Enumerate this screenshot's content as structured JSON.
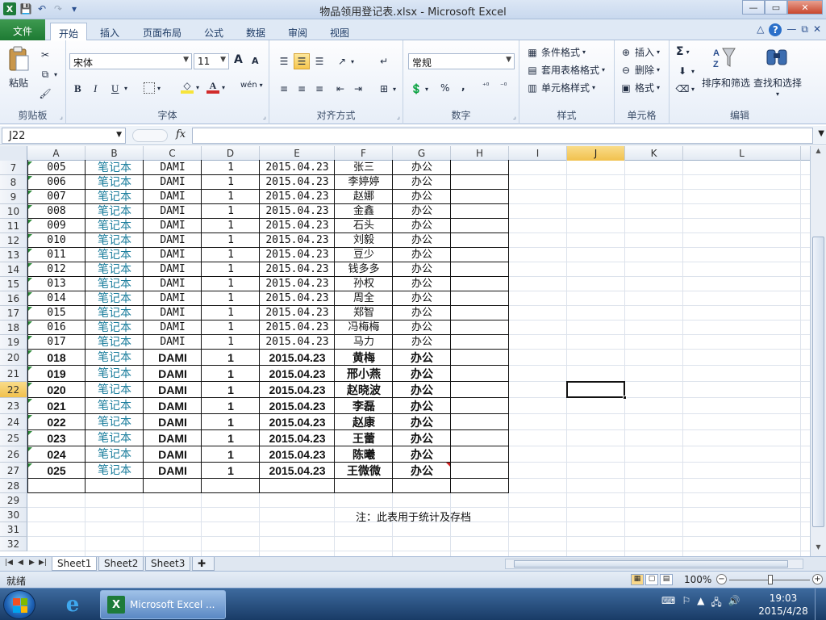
{
  "window": {
    "title": "物品领用登记表.xlsx - Microsoft Excel",
    "min": "—",
    "max": "▭",
    "close": "✕"
  },
  "qat": {
    "app": "X",
    "save": "💾",
    "undo": "↶",
    "redo": "↷",
    "more": "▾"
  },
  "tabs": [
    "文件",
    "开始",
    "插入",
    "页面布局",
    "公式",
    "数据",
    "审阅",
    "视图"
  ],
  "tabs_right": {
    "minimize_ribbon": "△",
    "help": "?",
    "min": "—",
    "restore": "⧉",
    "close": "✕"
  },
  "ribbon": {
    "clipboard": {
      "label": "剪贴板",
      "paste": "粘贴"
    },
    "font": {
      "label": "字体",
      "name": "宋体",
      "size": "11",
      "grow": "A",
      "shrink": "A",
      "bold": "B",
      "italic": "I",
      "underline": "U",
      "wen": "wén"
    },
    "alignment": {
      "label": "对齐方式"
    },
    "number": {
      "label": "数字",
      "format": "常规",
      "percent": "%",
      "comma": ","
    },
    "styles": {
      "label": "样式",
      "cond": "条件格式",
      "table": "套用表格格式",
      "cell": "单元格样式"
    },
    "cells": {
      "label": "单元格",
      "insert": "插入",
      "delete": "删除",
      "format": "格式"
    },
    "editing": {
      "label": "编辑",
      "sigma": "Σ",
      "sort": "排序和筛选",
      "find": "查找和选择"
    }
  },
  "formula_bar": {
    "name_box": "J22",
    "fx": "fx",
    "value": ""
  },
  "columns": [
    "A",
    "B",
    "C",
    "D",
    "E",
    "F",
    "G",
    "H",
    "I",
    "J",
    "K",
    "L"
  ],
  "selected_column": "J",
  "selected_row": "22",
  "rows": [
    {
      "n": "7",
      "a": "005",
      "b": "笔记本",
      "c": "DAMI",
      "d": "1",
      "e": "2015.04.23",
      "f": "张三",
      "g": "办公",
      "bold": false
    },
    {
      "n": "8",
      "a": "006",
      "b": "笔记本",
      "c": "DAMI",
      "d": "1",
      "e": "2015.04.23",
      "f": "李婷婷",
      "g": "办公",
      "bold": false
    },
    {
      "n": "9",
      "a": "007",
      "b": "笔记本",
      "c": "DAMI",
      "d": "1",
      "e": "2015.04.23",
      "f": "赵娜",
      "g": "办公",
      "bold": false
    },
    {
      "n": "10",
      "a": "008",
      "b": "笔记本",
      "c": "DAMI",
      "d": "1",
      "e": "2015.04.23",
      "f": "金鑫",
      "g": "办公",
      "bold": false
    },
    {
      "n": "11",
      "a": "009",
      "b": "笔记本",
      "c": "DAMI",
      "d": "1",
      "e": "2015.04.23",
      "f": "石头",
      "g": "办公",
      "bold": false
    },
    {
      "n": "12",
      "a": "010",
      "b": "笔记本",
      "c": "DAMI",
      "d": "1",
      "e": "2015.04.23",
      "f": "刘毅",
      "g": "办公",
      "bold": false
    },
    {
      "n": "13",
      "a": "011",
      "b": "笔记本",
      "c": "DAMI",
      "d": "1",
      "e": "2015.04.23",
      "f": "豆少",
      "g": "办公",
      "bold": false
    },
    {
      "n": "14",
      "a": "012",
      "b": "笔记本",
      "c": "DAMI",
      "d": "1",
      "e": "2015.04.23",
      "f": "钱多多",
      "g": "办公",
      "bold": false
    },
    {
      "n": "15",
      "a": "013",
      "b": "笔记本",
      "c": "DAMI",
      "d": "1",
      "e": "2015.04.23",
      "f": "孙权",
      "g": "办公",
      "bold": false
    },
    {
      "n": "16",
      "a": "014",
      "b": "笔记本",
      "c": "DAMI",
      "d": "1",
      "e": "2015.04.23",
      "f": "周全",
      "g": "办公",
      "bold": false
    },
    {
      "n": "17",
      "a": "015",
      "b": "笔记本",
      "c": "DAMI",
      "d": "1",
      "e": "2015.04.23",
      "f": "郑智",
      "g": "办公",
      "bold": false
    },
    {
      "n": "18",
      "a": "016",
      "b": "笔记本",
      "c": "DAMI",
      "d": "1",
      "e": "2015.04.23",
      "f": "冯梅梅",
      "g": "办公",
      "bold": false
    },
    {
      "n": "19",
      "a": "017",
      "b": "笔记本",
      "c": "DAMI",
      "d": "1",
      "e": "2015.04.23",
      "f": "马力",
      "g": "办公",
      "bold": false
    },
    {
      "n": "20",
      "a": "018",
      "b": "笔记本",
      "c": "DAMI",
      "d": "1",
      "e": "2015.04.23",
      "f": "黄梅",
      "g": "办公",
      "bold": true
    },
    {
      "n": "21",
      "a": "019",
      "b": "笔记本",
      "c": "DAMI",
      "d": "1",
      "e": "2015.04.23",
      "f": "邢小燕",
      "g": "办公",
      "bold": true
    },
    {
      "n": "22",
      "a": "020",
      "b": "笔记本",
      "c": "DAMI",
      "d": "1",
      "e": "2015.04.23",
      "f": "赵晓波",
      "g": "办公",
      "bold": true
    },
    {
      "n": "23",
      "a": "021",
      "b": "笔记本",
      "c": "DAMI",
      "d": "1",
      "e": "2015.04.23",
      "f": "李磊",
      "g": "办公",
      "bold": true
    },
    {
      "n": "24",
      "a": "022",
      "b": "笔记本",
      "c": "DAMI",
      "d": "1",
      "e": "2015.04.23",
      "f": "赵康",
      "g": "办公",
      "bold": true
    },
    {
      "n": "25",
      "a": "023",
      "b": "笔记本",
      "c": "DAMI",
      "d": "1",
      "e": "2015.04.23",
      "f": "王蕾",
      "g": "办公",
      "bold": true
    },
    {
      "n": "26",
      "a": "024",
      "b": "笔记本",
      "c": "DAMI",
      "d": "1",
      "e": "2015.04.23",
      "f": "陈曦",
      "g": "办公",
      "bold": true
    },
    {
      "n": "27",
      "a": "025",
      "b": "笔记本",
      "c": "DAMI",
      "d": "1",
      "e": "2015.04.23",
      "f": "王微微",
      "g": "办公",
      "bold": true
    },
    {
      "n": "28"
    },
    {
      "n": "29"
    },
    {
      "n": "30"
    },
    {
      "n": "31"
    },
    {
      "n": "32"
    }
  ],
  "note": "注：此表用于统计及存档",
  "sheets": [
    "Sheet1",
    "Sheet2",
    "Sheet3"
  ],
  "status": {
    "ready": "就绪",
    "zoom": "100%"
  },
  "taskbar": {
    "excel_label": "Microsoft Excel ...",
    "time": "19:03",
    "date": "2015/4/28"
  },
  "colors": {
    "accent_green": "#1d7a33",
    "teal_text": "#1a7d9c",
    "selected_header": "#f1c14d"
  }
}
